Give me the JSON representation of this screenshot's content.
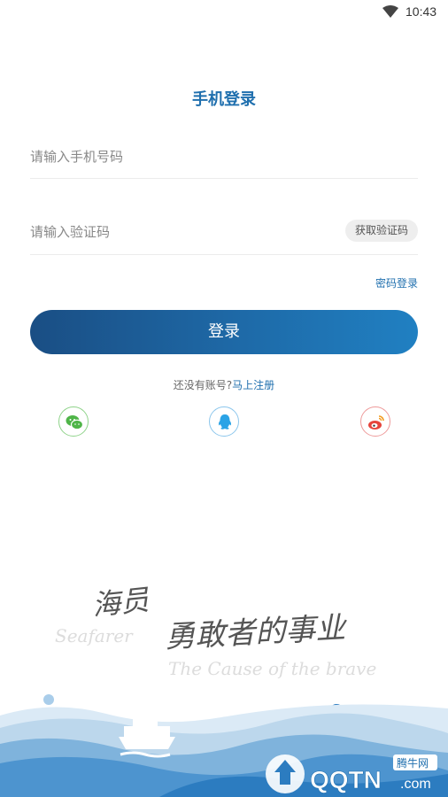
{
  "status_bar": {
    "time": "10:43"
  },
  "login": {
    "title": "手机登录",
    "phone_placeholder": "请输入手机号码",
    "code_placeholder": "请输入验证码",
    "get_code_label": "获取验证码",
    "password_login_label": "密码登录",
    "submit_label": "登录",
    "no_account_text": "还没有账号?",
    "register_label": "马上注册"
  },
  "social_logins": [
    {
      "name": "wechat-icon",
      "color": "#4fb548"
    },
    {
      "name": "qq-icon",
      "color": "#2aa3e6"
    },
    {
      "name": "weibo-icon",
      "color": "#e6443c"
    }
  ],
  "slogan": {
    "line_cn_1": "海员",
    "line_en_1": "Seafarer",
    "line_cn_2": "勇敢者的事业",
    "line_en_2": "The Cause of the brave"
  },
  "watermark": {
    "badge": "腾牛网",
    "text": "QQTN",
    "suffix": ".com"
  },
  "colors": {
    "accent": "#1f6fae",
    "button_start": "#1a4e84",
    "button_end": "#2080c2",
    "wave_light": "#bcd7ec",
    "wave_dark": "#2c7cc0"
  }
}
